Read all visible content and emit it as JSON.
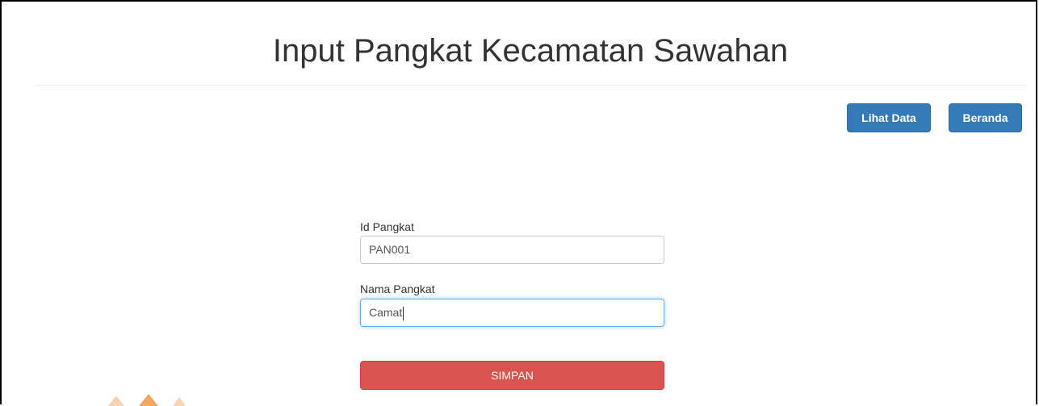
{
  "page": {
    "title": "Input Pangkat Kecamatan Sawahan"
  },
  "toolbar": {
    "lihat_data_label": "Lihat Data",
    "beranda_label": "Beranda"
  },
  "form": {
    "id_pangkat": {
      "label": "Id Pangkat",
      "value": "PAN001"
    },
    "nama_pangkat": {
      "label": "Nama Pangkat",
      "value": "Camat"
    },
    "submit_label": "SIMPAN"
  },
  "colors": {
    "primary": "#337ab7",
    "danger": "#d9534f",
    "focus": "#66afe9",
    "watermark": "#f08a2a"
  },
  "watermark": {
    "icon": "logo-watermark-icon"
  }
}
